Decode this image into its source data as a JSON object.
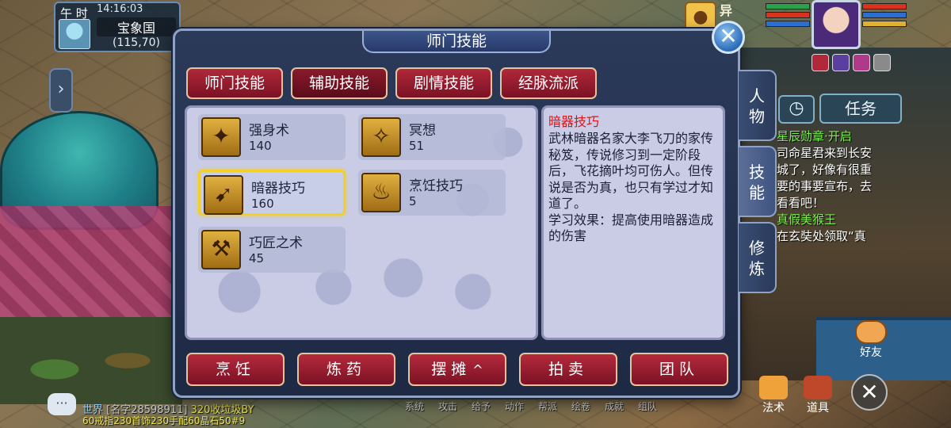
{
  "hud": {
    "period": "午 时",
    "clock": "14:16:03",
    "map_name": "宝象国",
    "coords": "(115,70)",
    "pet_name": "异"
  },
  "dialog": {
    "title": "师门技能",
    "close_icon": "close-icon",
    "tabs": [
      {
        "label": "师门技能",
        "active": false
      },
      {
        "label": "辅助技能",
        "active": true
      },
      {
        "label": "剧情技能",
        "active": false
      },
      {
        "label": "经脉流派",
        "active": false
      }
    ],
    "skills": [
      {
        "name": "强身术",
        "level": "140",
        "icon": "strength-icon",
        "selected": false
      },
      {
        "name": "冥想",
        "level": "51",
        "icon": "meditation-icon",
        "selected": false
      },
      {
        "name": "暗器技巧",
        "level": "160",
        "icon": "dart-icon",
        "selected": true
      },
      {
        "name": "烹饪技巧",
        "level": "5",
        "icon": "cooking-icon",
        "selected": false
      },
      {
        "name": "巧匠之术",
        "level": "45",
        "icon": "craftsman-icon",
        "selected": false
      }
    ],
    "description": {
      "title": "暗器技巧",
      "body": "武林暗器名家大李飞刀的家传秘笈，传说修习到一定阶段后，飞花摘叶均可伤人。但传说是否为真，也只有学过才知道了。",
      "effect": "学习效果：提高使用暗器造成的伤害"
    },
    "side_tabs": [
      {
        "label": "人物",
        "active": false
      },
      {
        "label": "技能",
        "active": true
      },
      {
        "label": "修炼",
        "active": false
      }
    ],
    "actions": [
      {
        "label": "烹饪"
      },
      {
        "label": "炼药"
      },
      {
        "label": "摆摊",
        "arrow": "^"
      },
      {
        "label": "拍卖"
      },
      {
        "label": "团队"
      }
    ]
  },
  "task_panel": {
    "button": "任务",
    "lines": [
      {
        "text": "星辰勋章·开启",
        "color": "green"
      },
      {
        "text": "司命星君来到长安",
        "color": "white"
      },
      {
        "text": "城了，好像有很重",
        "color": "white"
      },
      {
        "text": "要的事要宣布，去",
        "color": "white"
      },
      {
        "text": "看看吧！",
        "color": "white"
      },
      {
        "text": "真假美猴王",
        "color": "green"
      },
      {
        "text": "在玄奘处领取“真",
        "color": "white"
      }
    ]
  },
  "shortcuts": {
    "friends": "好友",
    "skills": "法术",
    "items": "道具"
  },
  "chat": {
    "channel": "世界",
    "name": "[名字28598911]",
    "message": "320收垃圾BY",
    "line2": "60戒指230首饰230手配60晶石50#9"
  },
  "bottom_menu": [
    "系统",
    "攻击",
    "给予",
    "动作",
    "帮派",
    "绘卷",
    "成就",
    "组队"
  ],
  "colors": {
    "accent_red": "#b0283a",
    "panel_bg": "#c9cce4",
    "selected_border": "#f2cf2b",
    "desc_title": "#e0121a"
  }
}
